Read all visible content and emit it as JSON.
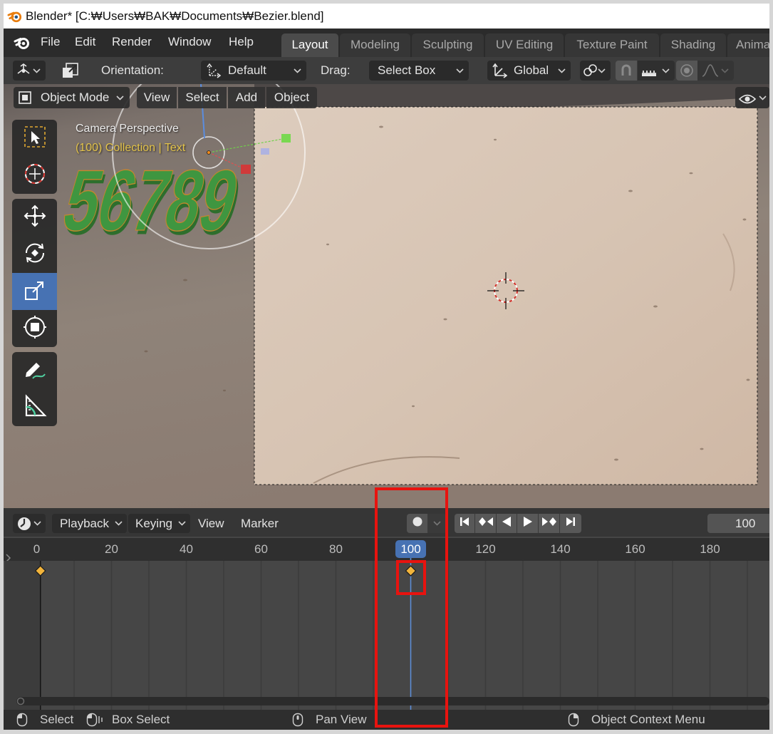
{
  "window": {
    "title": "Blender* [C:₩Users₩BAK₩Documents₩Bezier.blend]"
  },
  "menu": {
    "items": [
      "File",
      "Edit",
      "Render",
      "Window",
      "Help"
    ]
  },
  "workspaces": {
    "tabs": [
      "Layout",
      "Modeling",
      "Sculpting",
      "UV Editing",
      "Texture Paint",
      "Shading",
      "Anima"
    ],
    "active_index": 0
  },
  "tool_settings": {
    "orientation_label": "Orientation:",
    "orientation_value": "Default",
    "drag_label": "Drag:",
    "drag_value": "Select Box",
    "transform_orientation": "Global"
  },
  "viewport": {
    "mode": "Object Mode",
    "menus": [
      "View",
      "Select",
      "Add",
      "Object"
    ],
    "overlay_title": "Camera Perspective",
    "overlay_info": "(100) Collection | Text",
    "scene_text": "56789",
    "active_tool": "scale",
    "tools": [
      "select-box",
      "cursor",
      "move",
      "rotate",
      "scale",
      "transform",
      "annotate",
      "measure"
    ]
  },
  "timeline": {
    "menus": [
      "Playback",
      "Keying",
      "View",
      "Marker"
    ],
    "current_frame": 100,
    "frame_field": "100",
    "start_frame": 1,
    "ruler_frames": [
      0,
      20,
      40,
      60,
      80,
      100,
      120,
      140,
      160,
      180
    ],
    "keyframes": [
      1,
      100
    ]
  },
  "status_bar": {
    "items": [
      "Select",
      "Box Select",
      "Pan View",
      "Object Context Menu"
    ]
  },
  "colors": {
    "accent": "#4772b3",
    "keyframe": "#f2b43b",
    "overlay_info": "#e3c34a",
    "scene_text": "#3f9640",
    "annotation": "#e8130f"
  }
}
